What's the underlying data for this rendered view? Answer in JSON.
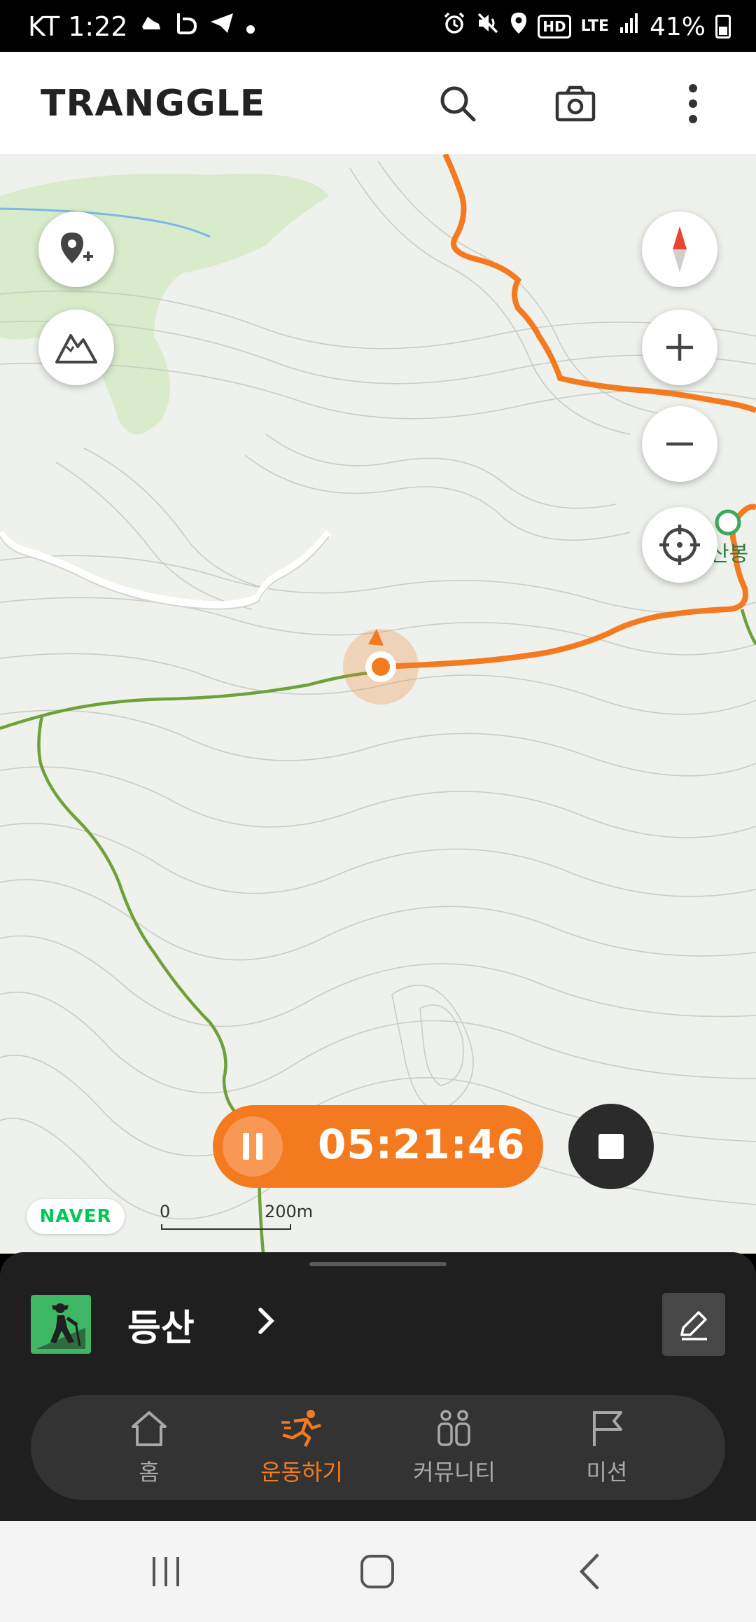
{
  "status_bar": {
    "carrier_time": "KT 1:22",
    "network": "LTE",
    "hd": "HD",
    "battery": "41%",
    "left_icons": [
      "shoe-icon",
      "b-logo-icon",
      "telegram-icon",
      "dot-icon"
    ],
    "right_icons": [
      "alarm-icon",
      "mute-icon",
      "location-icon",
      "hd-icon",
      "lte-icon",
      "signal-icon",
      "battery-icon"
    ]
  },
  "header": {
    "logo": "TRANGGLE",
    "actions": [
      "search-icon",
      "camera-icon",
      "more-icon"
    ]
  },
  "map": {
    "left_buttons": [
      "add-location-icon",
      "mountain-icon"
    ],
    "right_buttons": [
      "compass-icon",
      "zoom-in-icon",
      "zoom-out-icon",
      "locate-icon"
    ],
    "peak_label": "산봉",
    "provider": "NAVER",
    "scale_start": "0",
    "scale_end": "200m",
    "colors": {
      "track": "#f47a20",
      "trail": "#6ea13a",
      "forest": "#d6ebc6",
      "water": "#7fb6e6"
    }
  },
  "recording": {
    "timer": "05:21:46",
    "pause_icon": "pause-icon",
    "stop_icon": "stop-icon"
  },
  "sheet": {
    "activity_icon": "hiker-icon",
    "activity_label": "등산",
    "edit_icon": "pencil-icon"
  },
  "tabs": [
    {
      "label": "홈",
      "icon": "home-icon",
      "active": false
    },
    {
      "label": "운동하기",
      "icon": "running-icon",
      "active": true
    },
    {
      "label": "커뮤니티",
      "icon": "people-icon",
      "active": false
    },
    {
      "label": "미션",
      "icon": "flag-icon",
      "active": false
    }
  ],
  "system_nav": [
    "recent-apps-icon",
    "home-button-icon",
    "back-icon"
  ],
  "accent_color": "#f47a20"
}
